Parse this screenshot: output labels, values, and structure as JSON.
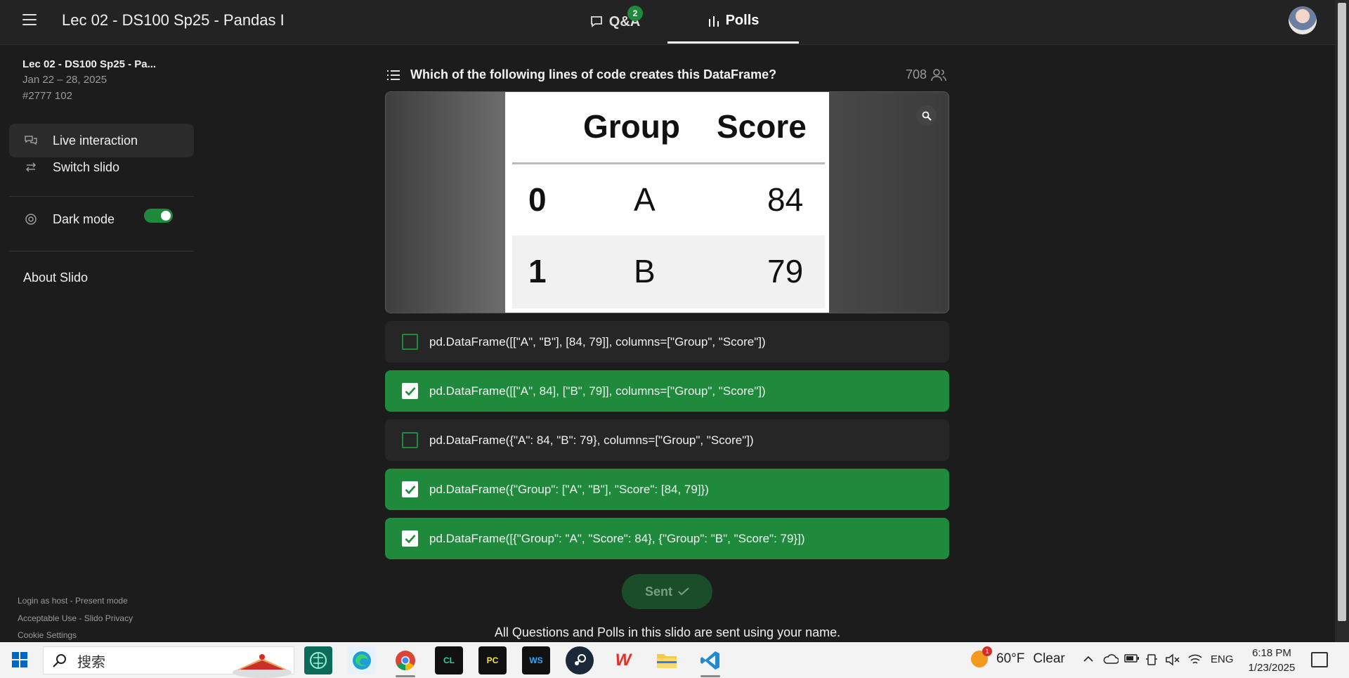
{
  "header": {
    "title": "Lec 02 - DS100 Sp25 - Pandas I",
    "tabs": [
      {
        "label": "Q&A",
        "badge": "2"
      },
      {
        "label": "Polls"
      }
    ]
  },
  "sidebar": {
    "event_name": "Lec 02 - DS100 Sp25 - Pa...",
    "event_dates": "Jan 22 – 28, 2025",
    "event_code": "#2777 102",
    "items": [
      {
        "label": "Live interaction"
      },
      {
        "label": "Switch slido"
      },
      {
        "label": "Dark mode"
      }
    ],
    "dark_mode_on": true,
    "about": "About Slido",
    "footer": {
      "line1": "Login as host - Present mode",
      "line2": "Acceptable Use - Slido Privacy",
      "line3": "Cookie Settings"
    }
  },
  "poll": {
    "question": "Which of the following lines of code creates this DataFrame?",
    "participants": "708",
    "dataframe": {
      "columns": [
        "Group",
        "Score"
      ],
      "rows": [
        {
          "index": "0",
          "group": "A",
          "score": "84"
        },
        {
          "index": "1",
          "group": "B",
          "score": "79"
        }
      ]
    },
    "options": [
      {
        "label": "pd.DataFrame([[\"A\", \"B\"], [84, 79]], columns=[\"Group\", \"Score\"])",
        "checked": false
      },
      {
        "label": "pd.DataFrame([[\"A\", 84], [\"B\", 79]], columns=[\"Group\", \"Score\"])",
        "checked": true
      },
      {
        "label": "pd.DataFrame({\"A\": 84, \"B\": 79}, columns=[\"Group\", \"Score\"])",
        "checked": false
      },
      {
        "label": "pd.DataFrame({\"Group\": [\"A\", \"B\"], \"Score\": [84, 79]})",
        "checked": true
      },
      {
        "label": "pd.DataFrame([{\"Group\": \"A\", \"Score\": 84}, {\"Group\": \"B\", \"Score\": 79}])",
        "checked": true
      }
    ],
    "submit_label": "Sent",
    "note": "All Questions and Polls in this slido are sent using your name."
  },
  "taskbar": {
    "search_text": "搜索",
    "apps": [
      {
        "name": "brain-app-icon",
        "label": ""
      },
      {
        "name": "edge-icon",
        "label": ""
      },
      {
        "name": "chrome-icon",
        "label": ""
      },
      {
        "name": "clion-icon",
        "label": "CL"
      },
      {
        "name": "pycharm-icon",
        "label": "PC"
      },
      {
        "name": "webstorm-icon",
        "label": "WS"
      },
      {
        "name": "steam-icon",
        "label": ""
      },
      {
        "name": "wps-icon",
        "label": "W"
      },
      {
        "name": "file-explorer-icon",
        "label": ""
      },
      {
        "name": "vscode-icon",
        "label": ""
      }
    ],
    "weather": {
      "temp": "60°F",
      "condition": "Clear",
      "notif": "1"
    },
    "language": "ENG",
    "time": "6:18 PM",
    "date": "1/23/2025"
  },
  "colors": {
    "accent_green": "#1f8a3c",
    "background": "#1c1c1c",
    "option_bg": "#262626"
  }
}
